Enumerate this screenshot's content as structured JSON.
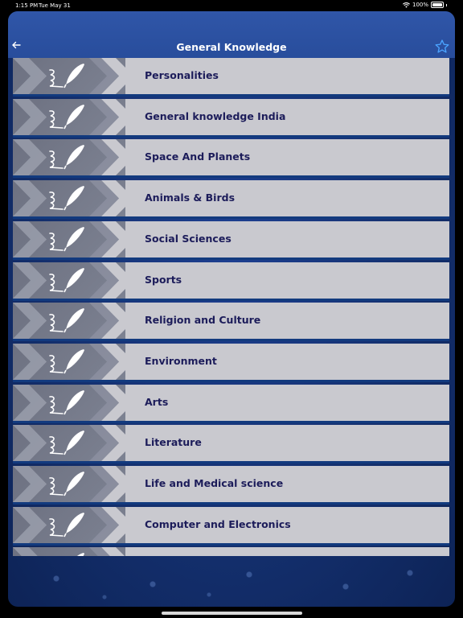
{
  "status": {
    "time": "1:15 PM",
    "date": "Tue May 31",
    "battery": "100%"
  },
  "nav": {
    "title": "General Knowledge",
    "back_icon": "arrow-left-icon",
    "favorite_icon": "star-icon"
  },
  "categories": [
    {
      "label": "Personalities"
    },
    {
      "label": "General knowledge India"
    },
    {
      "label": "Space And Planets"
    },
    {
      "label": "Animals & Birds"
    },
    {
      "label": "Social Sciences"
    },
    {
      "label": "Sports"
    },
    {
      "label": "Religion and Culture"
    },
    {
      "label": "Environment"
    },
    {
      "label": "Arts"
    },
    {
      "label": "Literature"
    },
    {
      "label": "Life and Medical science"
    },
    {
      "label": "Computer and Electronics"
    },
    {
      "label": ""
    }
  ],
  "colors": {
    "nav_bg": "#2b519f",
    "row_bg": "#c9c9cf",
    "label_text": "#1c1c5a",
    "star": "#4aa3ff"
  }
}
